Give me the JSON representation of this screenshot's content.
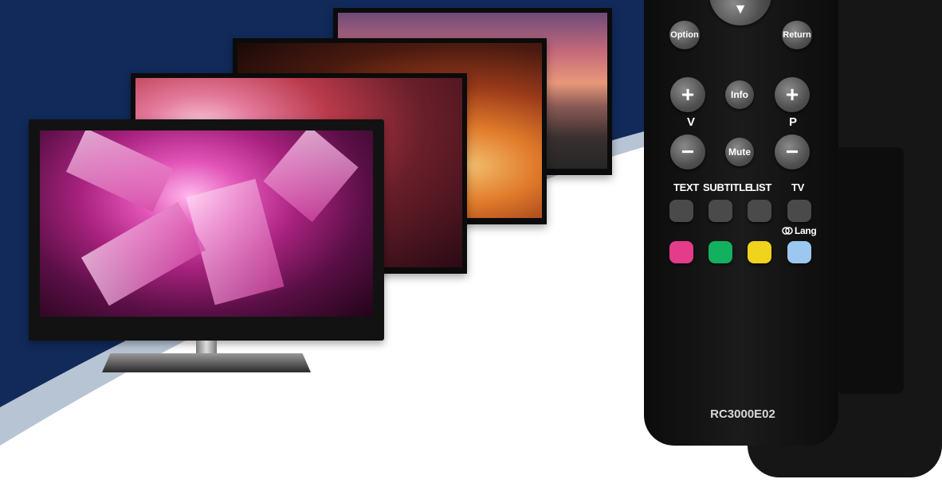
{
  "scene": {
    "background_colors": {
      "navy": "#112a5a",
      "silver": "#b7c4d4",
      "white": "#ffffff"
    },
    "tvs": [
      {
        "name": "sunset",
        "color": "#c56a7a"
      },
      {
        "name": "canyon",
        "color": "#e07a2a"
      },
      {
        "name": "rose-canyon",
        "color": "#e3789b"
      },
      {
        "name": "crystals",
        "color": "#e254b8"
      }
    ]
  },
  "remote": {
    "option_label": "Option",
    "return_label": "Return",
    "info_label": "Info",
    "mute_label": "Mute",
    "vol_label": "V",
    "prog_label": "P",
    "plus_symbol": "+",
    "minus_symbol": "−",
    "down_symbol": "▼",
    "text_label": "TEXT",
    "subtitle_label": "SUBTITLE",
    "list_label": "LIST",
    "tv_label": "TV",
    "lang_label": "Lang",
    "color_buttons": [
      "#e43b8a",
      "#13b060",
      "#f0d31c",
      "#9cc7f0"
    ],
    "model": "RC3000E02"
  }
}
